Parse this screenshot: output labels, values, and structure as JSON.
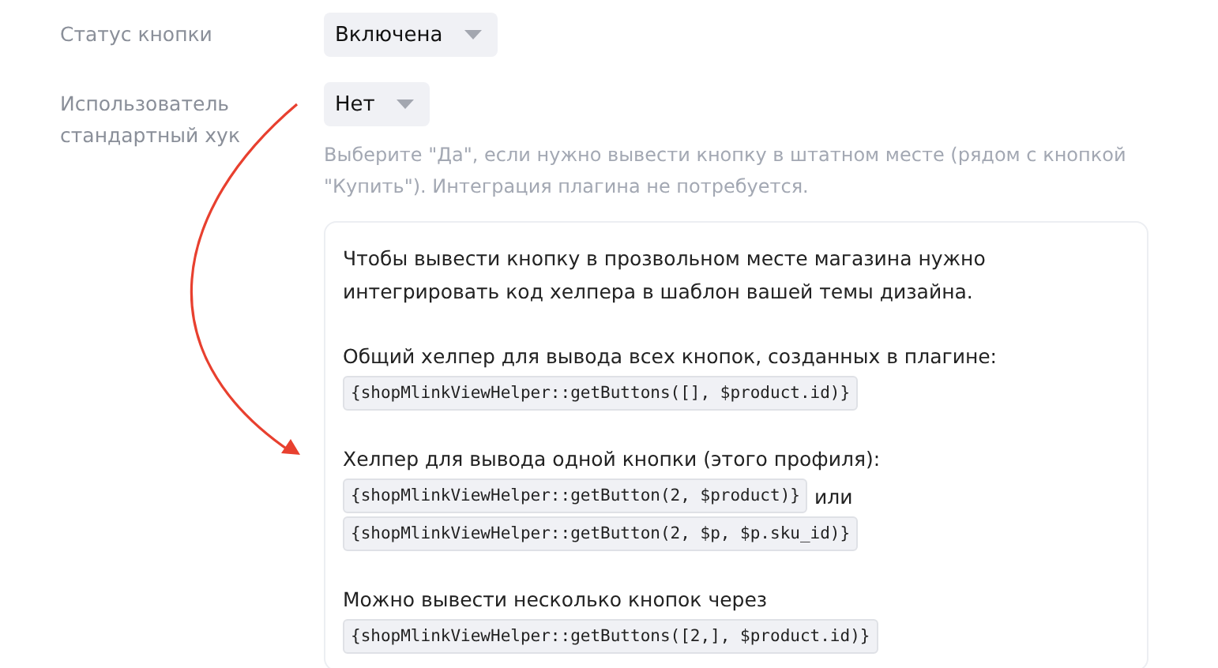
{
  "fields": [
    {
      "label": "Статус кнопки",
      "value": "Включена"
    },
    {
      "label": "Использователь стандартный хук",
      "value": "Нет",
      "hint": "Выберите \"Да\", если нужно вывести кнопку в штатном месте (рядом с кнопкой \"Купить\"). Интеграция плагина не потребуется."
    }
  ],
  "card": {
    "blocks": [
      {
        "kind": "text",
        "text": "Чтобы вывести кнопку в прозвольном месте магазина нужно интегрировать код хелпера в шаблон вашей темы дизайна."
      },
      {
        "kind": "helper",
        "caption": "Общий хелпер для вывода всех кнопок, созданных в плагине:",
        "lines": [
          {
            "code": "{shopMlinkViewHelper::getButtons([], $product.id)}"
          }
        ]
      },
      {
        "kind": "helper",
        "caption": "Хелпер для вывода одной кнопки (этого профиля):",
        "lines": [
          {
            "code": "{shopMlinkViewHelper::getButton(2, $product)}",
            "suffix": "или"
          },
          {
            "code": "{shopMlinkViewHelper::getButton(2, $p, $p.sku_id)}"
          }
        ]
      },
      {
        "kind": "helper",
        "caption": "Можно вывести несколько кнопок через",
        "lines": [
          {
            "code": "{shopMlinkViewHelper::getButtons([2,], $product.id)}"
          }
        ]
      }
    ]
  }
}
